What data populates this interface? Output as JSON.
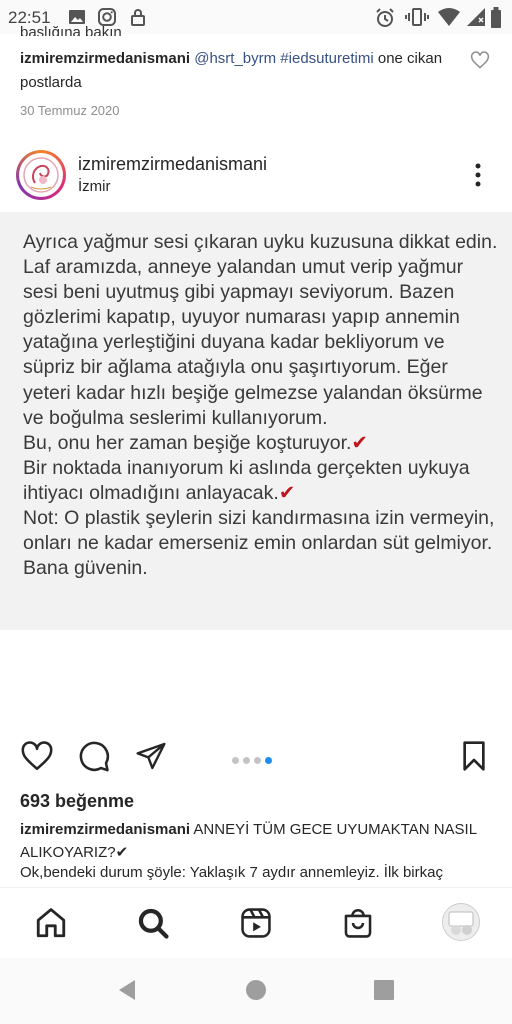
{
  "status_bar": {
    "time": "22:51",
    "left_icons": [
      "image-icon",
      "instagram-icon",
      "lock-icon"
    ],
    "right_icons": [
      "alarm-icon",
      "vibrate-icon",
      "wifi-icon",
      "signal-icon",
      "battery-icon"
    ]
  },
  "previous_post": {
    "cut_text": "başlığına bakın",
    "comment_user": "izmiremzirmedanismani",
    "comment_tags": "@hsrt_byrm #iedsuturetimi",
    "comment_text": " one cikan postlarda",
    "date": "30 Temmuz 2020"
  },
  "post": {
    "username": "izmiremzirmedanismani",
    "location": "İzmir",
    "text_blocks": [
      "Ayrıca yağmur sesi çıkaran uyku kuzusuna dikkat edin. Laf aramızda, anneye yalandan umut verip yağmur sesi beni uyutmuş gibi yapmayı seviyorum. Bazen gözlerimi kapatıp, uyuyor numarası yapıp annemin yatağına yerleştiğini duyana kadar bekliyorum ve süpriz bir ağlama atağıyla onu şaşırtıyorum. Eğer yeteri kadar hızlı beşiğe gelmezse yalandan öksürme ve boğulma seslerimi kullanıyorum.",
      "Bu, onu her zaman beşiğe koşturuyor.✔",
      "Bir noktada inanıyorum ki aslında gerçekten uykuya ihtiyacı olmadığını anlayacak.✔",
      "Not: O plastik şeylerin sizi kandırmasına izin vermeyin, onları ne kadar emerseniz emin onlardan süt gelmiyor. Bana güvenin."
    ],
    "carousel": {
      "count": 4,
      "active_index": 4
    },
    "likes": "693 beğenme",
    "caption_user": "izmiremzirmedanismani",
    "caption_text": " ANNEYİ TÜM GECE UYUMAKTAN NASIL ALIKOYARIZ?✔",
    "caption_more": "Ok,bendeki durum şöyle: Yaklaşık 7 aydır annemleyiz. İlk birkaç"
  },
  "colors": {
    "text": "#262626",
    "muted": "#8e8e8e",
    "link": "#385185",
    "checkmark": "#c0141c",
    "carousel_active": "#1f8ef1"
  }
}
